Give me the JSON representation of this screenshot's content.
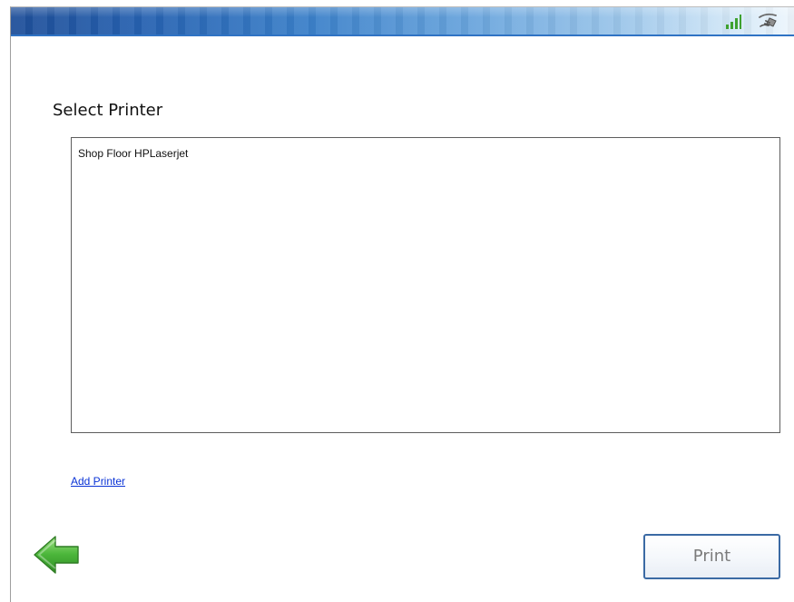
{
  "screen": {
    "title": "Select Printer"
  },
  "printers": {
    "items": [
      "Shop Floor HPLaserjet"
    ]
  },
  "actions": {
    "add_printer": "Add Printer",
    "print": "Print"
  },
  "icons": {
    "status": [
      "signal-icon",
      "plug-icon"
    ],
    "navigation": "back-arrow-icon"
  },
  "colors": {
    "header_start": "#1f4f99",
    "header_end": "#eef6fd",
    "link": "#0a33d6",
    "button_border": "#3b6aa4",
    "button_text": "#7b7b7b",
    "back_arrow": "#3d9d2d"
  }
}
